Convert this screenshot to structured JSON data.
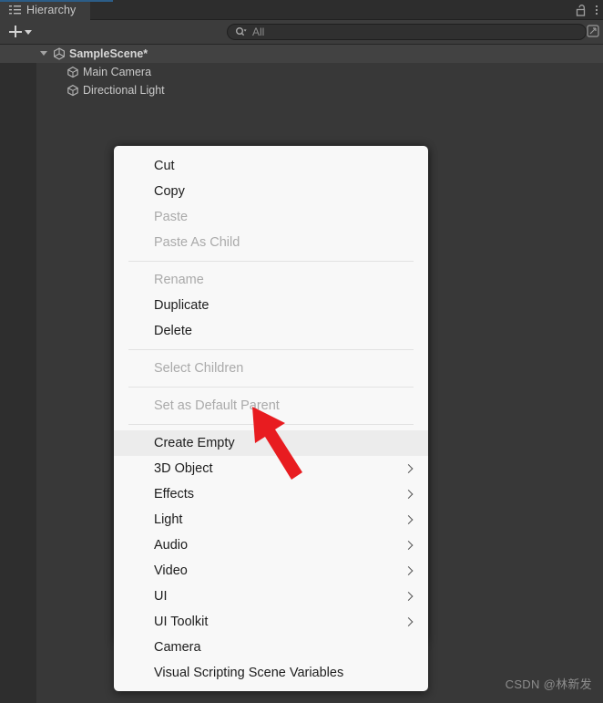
{
  "window": {
    "tab": {
      "label": "Hierarchy",
      "icon": "hierarchy-icon",
      "accent_color": "#2c5d87"
    },
    "lock_icon": "lock-open-icon",
    "menu_icon": "kebab-menu-icon"
  },
  "toolbar": {
    "add_button": {
      "icon": "plus-icon",
      "dropdown_icon": "chevron-down-icon"
    },
    "search": {
      "icon": "search-icon",
      "placeholder": "All",
      "value": "",
      "expand_icon": "expand-icon"
    }
  },
  "hierarchy": {
    "rows": [
      {
        "label": "SampleScene*",
        "icon": "unity-scene-icon",
        "depth": 0,
        "expanded": true,
        "selected": true
      },
      {
        "label": "Main Camera",
        "icon": "gameobject-cube-icon",
        "depth": 1,
        "expanded": false,
        "selected": false
      },
      {
        "label": "Directional Light",
        "icon": "gameobject-cube-icon",
        "depth": 1,
        "expanded": false,
        "selected": false
      }
    ]
  },
  "context_menu": {
    "items": [
      {
        "label": "Cut",
        "enabled": true,
        "submenu": false
      },
      {
        "label": "Copy",
        "enabled": true,
        "submenu": false
      },
      {
        "label": "Paste",
        "enabled": false,
        "submenu": false
      },
      {
        "label": "Paste As Child",
        "enabled": false,
        "submenu": false
      },
      {
        "separator": true
      },
      {
        "label": "Rename",
        "enabled": false,
        "submenu": false
      },
      {
        "label": "Duplicate",
        "enabled": true,
        "submenu": false
      },
      {
        "label": "Delete",
        "enabled": true,
        "submenu": false
      },
      {
        "separator": true
      },
      {
        "label": "Select Children",
        "enabled": false,
        "submenu": false
      },
      {
        "separator": true
      },
      {
        "label": "Set as Default Parent",
        "enabled": false,
        "submenu": false
      },
      {
        "separator": true
      },
      {
        "label": "Create Empty",
        "enabled": true,
        "submenu": false,
        "highlighted": true
      },
      {
        "label": "3D Object",
        "enabled": true,
        "submenu": true
      },
      {
        "label": "Effects",
        "enabled": true,
        "submenu": true
      },
      {
        "label": "Light",
        "enabled": true,
        "submenu": true
      },
      {
        "label": "Audio",
        "enabled": true,
        "submenu": true
      },
      {
        "label": "Video",
        "enabled": true,
        "submenu": true
      },
      {
        "label": "UI",
        "enabled": true,
        "submenu": true
      },
      {
        "label": "UI Toolkit",
        "enabled": true,
        "submenu": true
      },
      {
        "label": "Camera",
        "enabled": true,
        "submenu": false
      },
      {
        "label": "Visual Scripting Scene Variables",
        "enabled": true,
        "submenu": false
      }
    ]
  },
  "annotation": {
    "arrow_color": "#e81c20",
    "points_to": "Create Empty"
  },
  "watermark": {
    "text": "CSDN @林新发"
  }
}
